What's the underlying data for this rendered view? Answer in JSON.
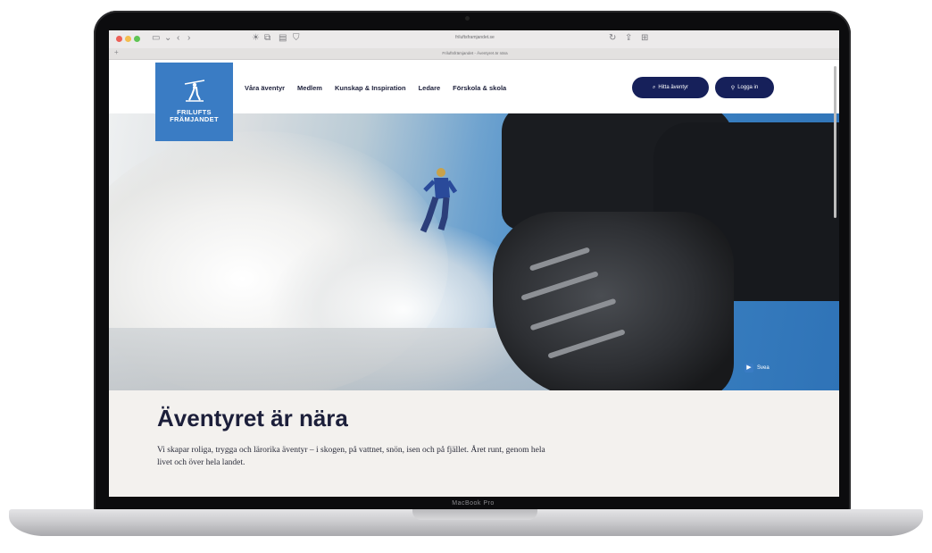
{
  "device": {
    "label": "MacBook Pro"
  },
  "browser": {
    "url": "friluftsframjandet.se",
    "tab_title": "Friluftsfrämjandet - Äventyret är nära"
  },
  "site": {
    "logo_text": "FRILUFTS\nFRÄMJANDET",
    "nav": [
      "Våra äventyr",
      "Medlem",
      "Kunskap & Inspiration",
      "Ledare",
      "Förskola & skola"
    ],
    "search_button": "Hitta äventyr",
    "login_button": "Logga in"
  },
  "hero": {
    "badge": "Svea"
  },
  "content": {
    "headline": "Äventyret är nära",
    "lead": "Vi skapar roliga, trygga och lärorika äventyr – i skogen, på vattnet, snön, isen och på fjället. Året runt, genom hela livet och över hela landet."
  },
  "colors": {
    "brand_blue": "#3a7cc4",
    "navy": "#16205a",
    "text_dark": "#1c1f3a",
    "content_bg": "#f3f1ee"
  }
}
